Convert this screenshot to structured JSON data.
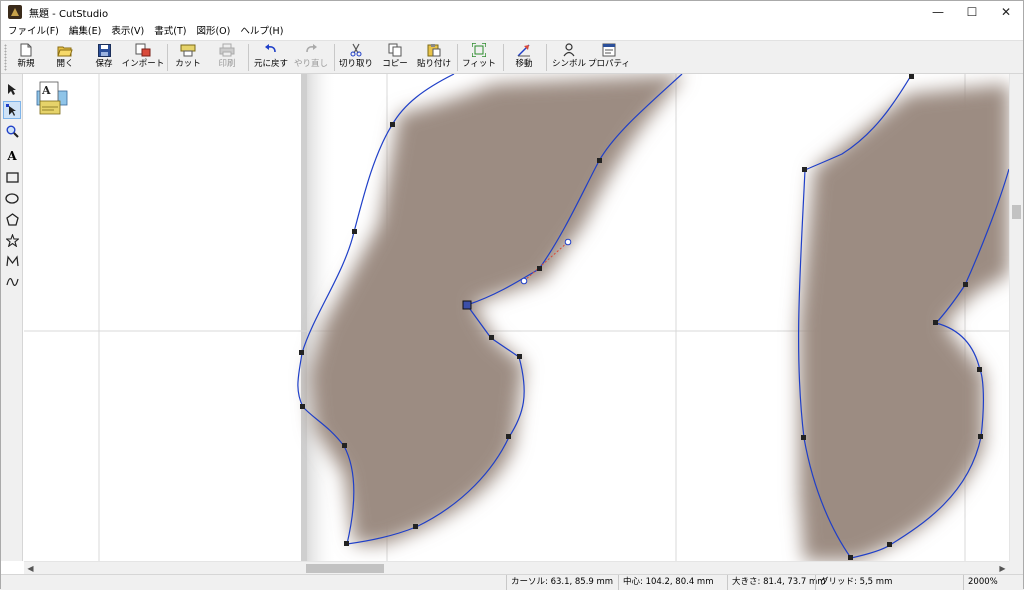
{
  "window": {
    "title": "無題 - CutStudio",
    "minimize": "—",
    "maximize": "☐",
    "close": "✕"
  },
  "menu": [
    {
      "label": "ファイル(F)"
    },
    {
      "label": "編集(E)"
    },
    {
      "label": "表示(V)"
    },
    {
      "label": "書式(T)"
    },
    {
      "label": "図形(O)"
    },
    {
      "label": "ヘルプ(H)"
    }
  ],
  "toolbar": {
    "new": {
      "label": "新規",
      "icon": "new-document-icon"
    },
    "open": {
      "label": "開く",
      "icon": "open-folder-icon"
    },
    "save": {
      "label": "保存",
      "icon": "floppy-disk-icon"
    },
    "import": {
      "label": "インポート",
      "icon": "import-icon"
    },
    "cut_job": {
      "label": "カット",
      "icon": "cutter-icon"
    },
    "print": {
      "label": "印刷",
      "icon": "printer-icon",
      "disabled": true
    },
    "undo": {
      "label": "元に戻す",
      "icon": "undo-icon"
    },
    "redo": {
      "label": "やり直し",
      "icon": "redo-icon",
      "disabled": true
    },
    "cut": {
      "label": "切り取り",
      "icon": "scissors-icon"
    },
    "copy": {
      "label": "コピー",
      "icon": "copy-icon"
    },
    "paste": {
      "label": "貼り付け",
      "icon": "paste-icon"
    },
    "fit": {
      "label": "フィット",
      "icon": "fit-icon"
    },
    "move": {
      "label": "移動",
      "icon": "move-icon"
    },
    "symbol": {
      "label": "シンボル",
      "icon": "symbol-icon"
    },
    "property": {
      "label": "プロパティ",
      "icon": "property-icon"
    }
  },
  "tools": [
    {
      "name": "select-arrow-icon",
      "glyph": "➤"
    },
    {
      "name": "node-edit-icon",
      "glyph": "↖"
    },
    {
      "name": "zoom-icon",
      "glyph": "🔍"
    },
    {
      "name": "text-tool-icon",
      "glyph": "A"
    },
    {
      "name": "rectangle-tool-icon",
      "glyph": "▭"
    },
    {
      "name": "ellipse-tool-icon",
      "glyph": "◯"
    },
    {
      "name": "pentagon-tool-icon",
      "glyph": "⬠"
    },
    {
      "name": "star-tool-icon",
      "glyph": "☆"
    },
    {
      "name": "polyline-tool-icon",
      "glyph": "⋀"
    },
    {
      "name": "curve-tool-icon",
      "glyph": "∿"
    }
  ],
  "status": {
    "cursor": "カーソル: 63.1, 85.9 mm",
    "center": "中心: 104.2, 80.4 mm",
    "size": "大きさ: 81.4, 73.7 mm",
    "grid": "グリッド: 5,5 mm",
    "zoom": "2000%"
  },
  "colors": {
    "path_stroke": "#1f3fc8",
    "shape_fill": "#9c8c82",
    "guide_line": "#d8d8d8",
    "toolbar_bg": "#f0f0f0"
  }
}
